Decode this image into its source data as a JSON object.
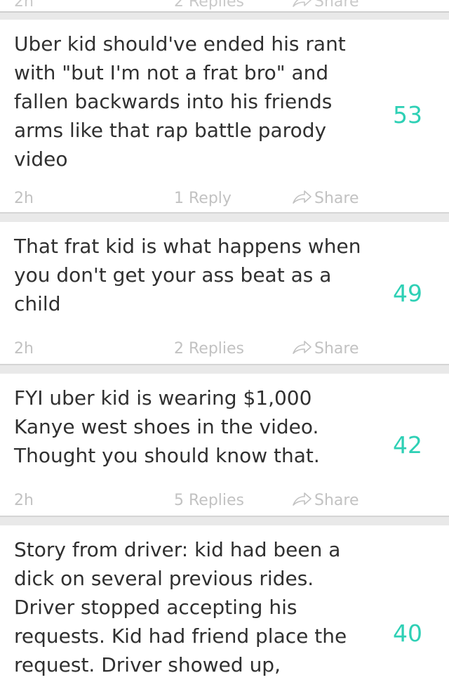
{
  "top_partial": {
    "age": "2h",
    "replies": "2 Replies",
    "share": "Share"
  },
  "colors": {
    "accent": "#2ed0b5",
    "text": "#303030",
    "meta": "#c2c2c2"
  },
  "posts": [
    {
      "text": "Uber kid should've ended his rant with \"but I'm not a frat bro\" and fallen backwards into his friends arms like that rap battle parody video",
      "votes": "53",
      "age": "2h",
      "replies": "1 Reply",
      "share": "Share"
    },
    {
      "text": "That frat kid is what happens when you don't get your ass beat as a child",
      "votes": "49",
      "age": "2h",
      "replies": "2 Replies",
      "share": "Share"
    },
    {
      "text": "FYI uber kid is wearing $1,000 Kanye west shoes in the video. Thought you should know that.",
      "votes": "42",
      "age": "2h",
      "replies": "5 Replies",
      "share": "Share"
    },
    {
      "text": "Story from driver: kid had been a dick on several previous rides. Driver stopped accepting his requests. Kid had friend place the request. Driver showed up,",
      "votes": "40"
    }
  ]
}
